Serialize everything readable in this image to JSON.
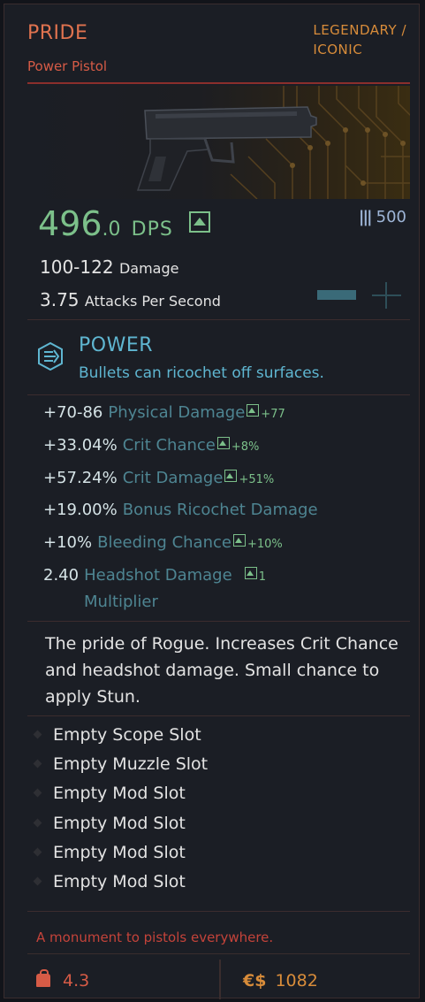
{
  "item": {
    "name": "PRIDE",
    "type": "Power Pistol",
    "rarity_line1": "LEGENDARY /",
    "rarity_line2": "ICONIC"
  },
  "stats": {
    "dps_int": "496",
    "dps_dec": ".0",
    "dps_unit": "DPS",
    "ammo": "500",
    "damage_value": "100-122",
    "damage_label": "Damage",
    "aps_value": "3.75",
    "aps_label": "Attacks Per Second"
  },
  "power": {
    "name": "POWER",
    "description": "Bullets can ricochet off surfaces."
  },
  "attributes": [
    {
      "value": "+70-86",
      "name": "Physical Damage",
      "bonus": "+77"
    },
    {
      "value": "+33.04%",
      "name": "Crit Chance",
      "bonus": "+8%"
    },
    {
      "value": "+57.24%",
      "name": "Crit Damage",
      "bonus": "+51%"
    },
    {
      "value": "+19.00%",
      "name": "Bonus Ricochet Damage",
      "bonus": ""
    },
    {
      "value": "+10%",
      "name": "Bleeding Chance",
      "bonus": "+10%"
    },
    {
      "value": "2.40",
      "name": "Headshot Damage",
      "name2": "Multiplier",
      "bonus": "1"
    }
  ],
  "description": "The pride of Rogue. Increases Crit Chance and headshot damage. Small chance to apply Stun.",
  "slots": [
    "Empty Scope Slot",
    "Empty Muzzle Slot",
    "Empty Mod Slot",
    "Empty Mod Slot",
    "Empty Mod Slot",
    "Empty Mod Slot"
  ],
  "flavor": "A monument to pistols everywhere.",
  "footer": {
    "weight": "4.3",
    "currency_symbol": "€$",
    "price": "1082"
  },
  "colors": {
    "accent_red": "#d65b46",
    "accent_gold": "#d88c3a",
    "dps_green": "#7cc08a",
    "power_cyan": "#5fb6d1"
  }
}
